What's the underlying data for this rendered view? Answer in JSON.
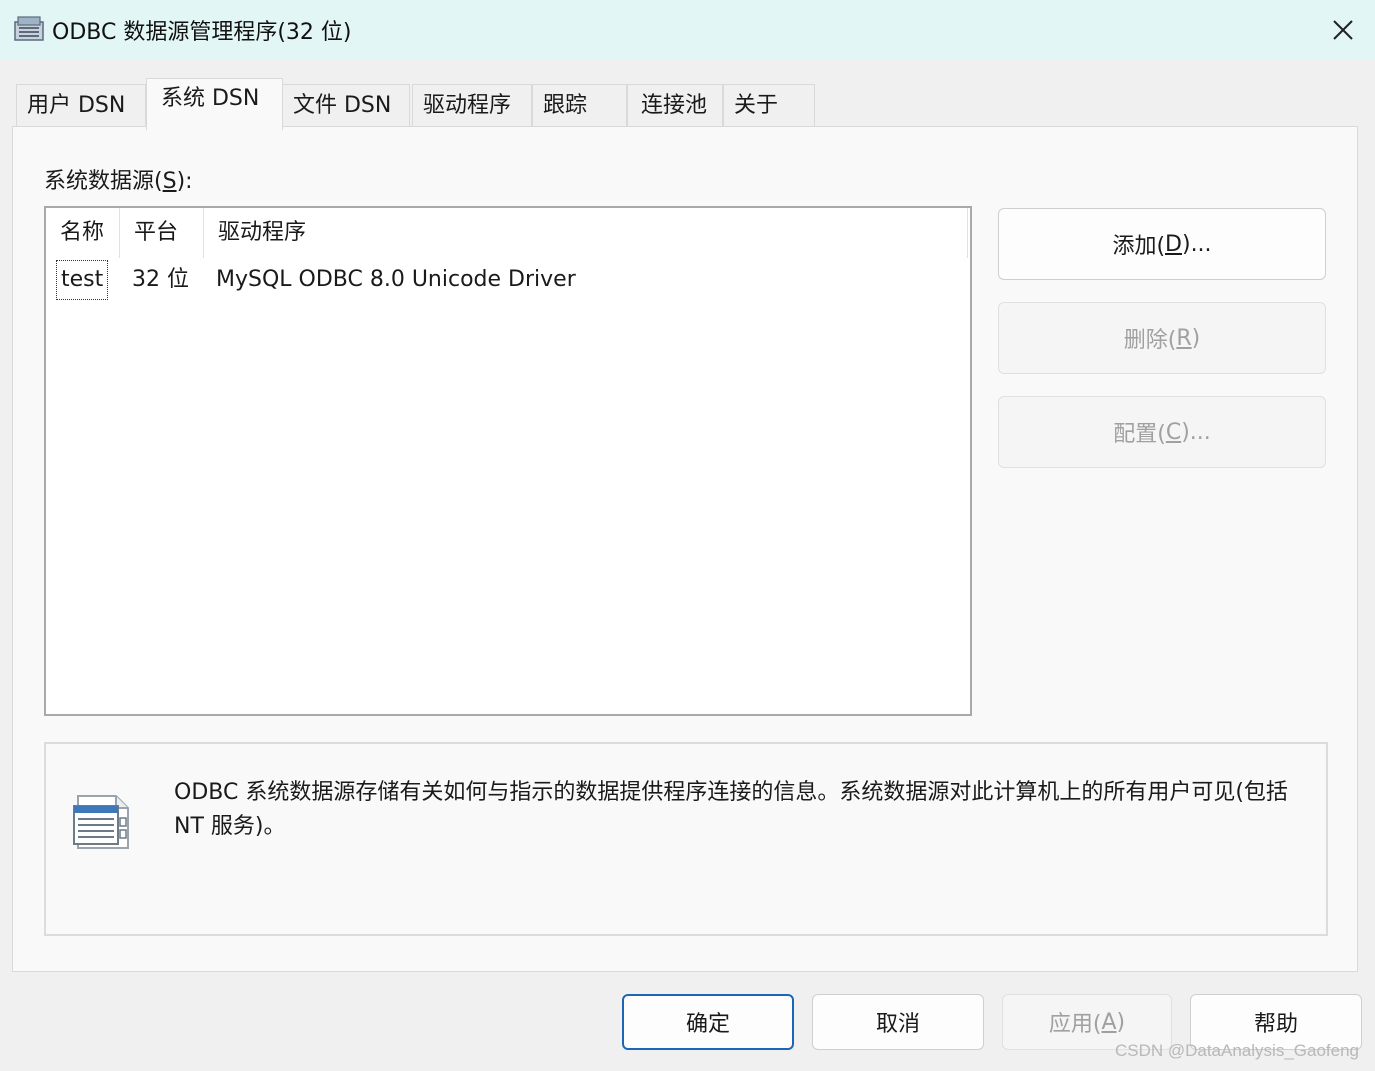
{
  "window": {
    "title": "ODBC 数据源管理程序(32 位)",
    "icon": "odbc-app-icon",
    "close_icon": "close-icon"
  },
  "tabs": [
    {
      "label": "用户 DSN",
      "active": false
    },
    {
      "label": "系统 DSN",
      "active": true
    },
    {
      "label": "文件 DSN",
      "active": false
    },
    {
      "label": "驱动程序",
      "active": false
    },
    {
      "label": "跟踪",
      "active": false
    },
    {
      "label": "连接池",
      "active": false
    },
    {
      "label": "关于",
      "active": false
    }
  ],
  "system_dsn": {
    "group_label": "系统数据源(",
    "group_label_key": "S",
    "group_label_tail": "):",
    "columns": [
      "名称",
      "平台",
      "驱动程序"
    ],
    "rows": [
      {
        "name": "test",
        "platform": "32 位",
        "driver": "MySQL ODBC 8.0 Unicode Driver"
      }
    ],
    "buttons": {
      "add": {
        "label": "添加(",
        "key": "D",
        "tail": ")...",
        "enabled": true
      },
      "remove": {
        "label": "删除(",
        "key": "R",
        "tail": ")",
        "enabled": false
      },
      "configure": {
        "label": "配置(",
        "key": "C",
        "tail": ")...",
        "enabled": false
      }
    },
    "info": {
      "icon": "data-source-icon",
      "text": "ODBC 系统数据源存储有关如何与指示的数据提供程序连接的信息。系统数据源对此计算机上的所有用户可见(包括 NT 服务)。"
    }
  },
  "footer": {
    "ok": {
      "label": "确定",
      "enabled": true
    },
    "cancel": {
      "label": "取消",
      "enabled": true
    },
    "apply": {
      "label": "应用(",
      "key": "A",
      "tail": ")",
      "enabled": false
    },
    "help": {
      "label": "帮助",
      "enabled": true
    }
  },
  "watermark": "CSDN @DataAnalysis_Gaofeng",
  "colors": {
    "titlebar_bg": "#e3f6f6",
    "default_button_border": "#1e66b5",
    "disabled_text": "#a0a0a0"
  }
}
